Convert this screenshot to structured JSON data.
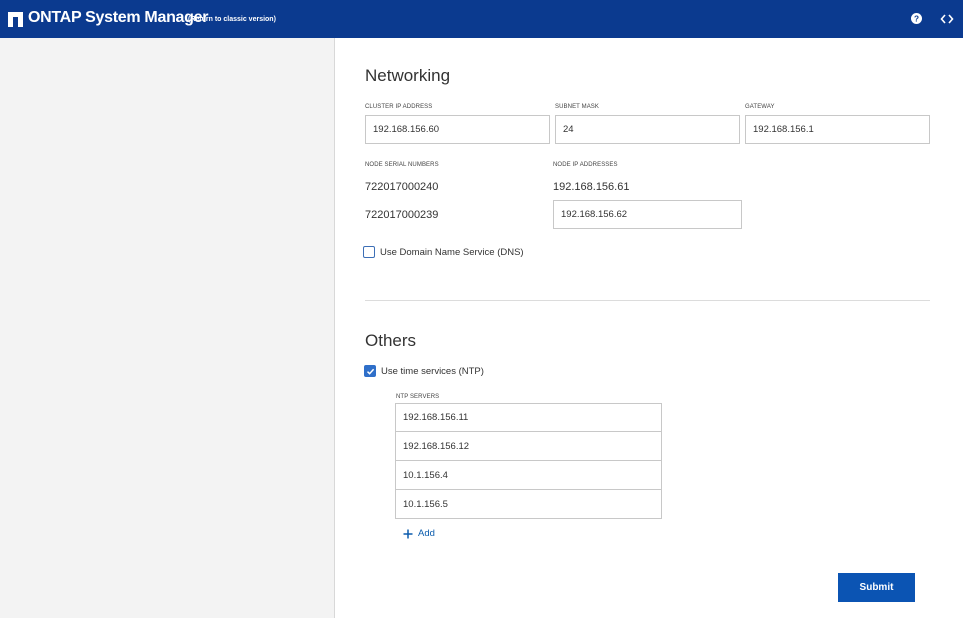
{
  "header": {
    "app_title": "ONTAP System Manager",
    "classic_link": "(Return to classic version)",
    "help_icon": "question-circle-icon",
    "code_icon": "code-brackets-icon",
    "logo": "netapp-logo"
  },
  "networking": {
    "title": "Networking",
    "cluster_ip_label": "CLUSTER IP ADDRESS",
    "cluster_ip_value": "192.168.156.60",
    "subnet_mask_label": "SUBNET MASK",
    "subnet_mask_value": "24",
    "gateway_label": "GATEWAY",
    "gateway_value": "192.168.156.1",
    "node_serial_label": "NODE SERIAL NUMBERS",
    "node_ip_label": "NODE IP ADDRESSES",
    "nodes": [
      {
        "serial": "722017000240",
        "ip": "192.168.156.61"
      },
      {
        "serial": "722017000239",
        "ip": "192.168.156.62"
      }
    ],
    "dns_label": "Use Domain Name Service (DNS)",
    "dns_checked": false
  },
  "others": {
    "title": "Others",
    "ntp_label": "Use time services (NTP)",
    "ntp_checked": true,
    "ntp_servers_label": "NTP SERVERS",
    "ntp_servers": [
      "192.168.156.11",
      "192.168.156.12",
      "10.1.156.4",
      "10.1.156.5"
    ],
    "add_label": "Add",
    "add_icon": "plus-icon"
  },
  "actions": {
    "submit_label": "Submit"
  },
  "colors": {
    "header_bg": "#0b3a8f",
    "accent": "#0b54b3"
  }
}
